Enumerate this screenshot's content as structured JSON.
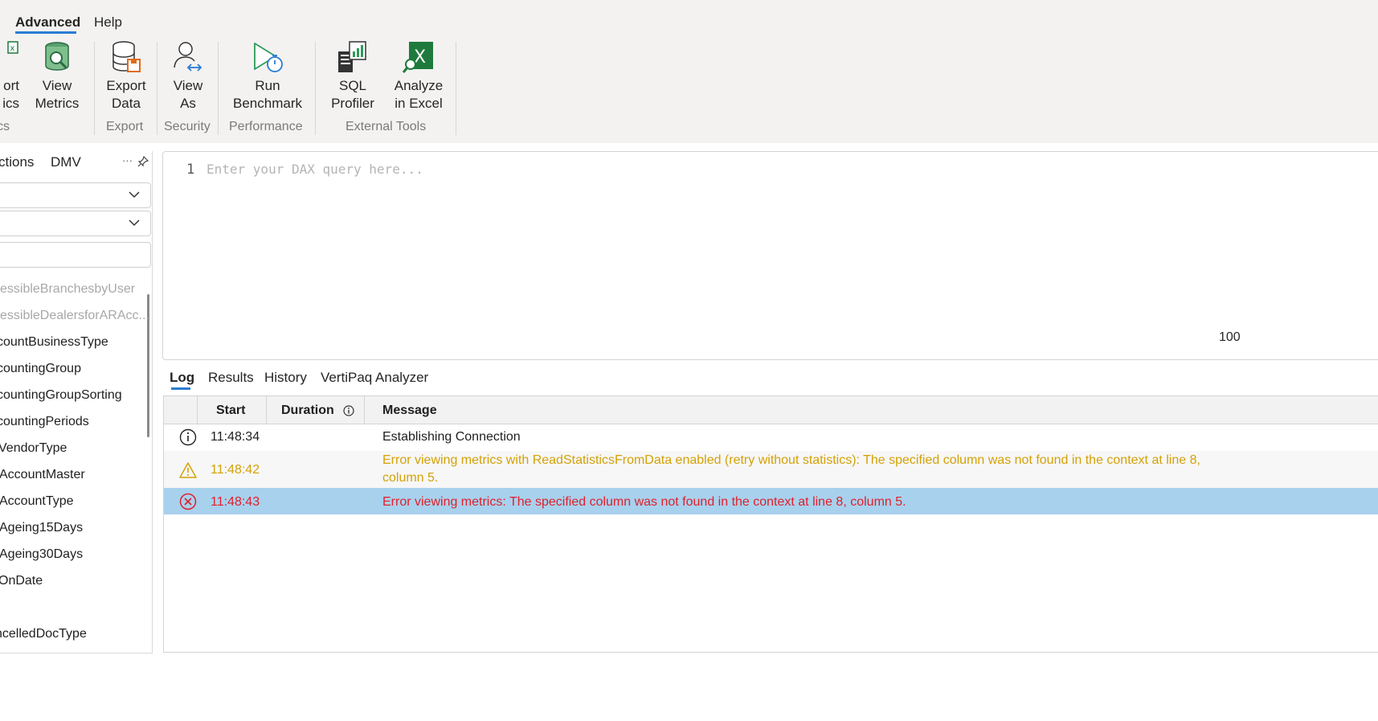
{
  "menu": {
    "tabs": [
      "Advanced",
      "Help"
    ]
  },
  "ribbon": {
    "buttons": {
      "export_metrics": [
        "ort",
        "ics"
      ],
      "view_metrics": [
        "View",
        "Metrics"
      ],
      "export_data": [
        "Export",
        "Data"
      ],
      "view_as": [
        "View",
        "As"
      ],
      "run_benchmark": [
        "Run",
        "Benchmark"
      ],
      "sql_profiler": [
        "SQL",
        "Profiler"
      ],
      "analyze_in_excel": [
        "Analyze",
        "in Excel"
      ]
    },
    "groups": {
      "metrics": "cs",
      "export": "Export",
      "security": "Security",
      "performance": "Performance",
      "external_tools": "External Tools"
    }
  },
  "left_panel": {
    "tabs": [
      "ctions",
      "DMV"
    ],
    "more_icon": "more-icon",
    "pin_icon": "pin-icon",
    "items": [
      "cessibleBranchesbyUser",
      "cessibleDealersforARAcc...",
      "countBusinessType",
      "countingGroup",
      "countingGroupSorting",
      "countingPeriods",
      "VendorType",
      "AccountMaster",
      "AccountType",
      "Ageing15Days",
      "Ageing30Days",
      "OnDate",
      "",
      "ncelledDocType"
    ]
  },
  "editor": {
    "line_number": "1",
    "placeholder": "Enter your DAX query here...",
    "zoom": "100"
  },
  "bottom_tabs": [
    "Log",
    "Results",
    "History",
    "VertiPaq Analyzer"
  ],
  "log": {
    "columns": [
      "Start",
      "Duration",
      "Message"
    ],
    "rows": [
      {
        "level": "info",
        "start": "11:48:34",
        "message": "Establishing Connection"
      },
      {
        "level": "warning",
        "start": "11:48:42",
        "message": "Error viewing metrics with ReadStatisticsFromData enabled (retry without statistics): The specified column was not found in the context at line 8, column 5."
      },
      {
        "level": "error",
        "start": "11:48:43",
        "message": "Error viewing metrics: The specified column was not found in the context at line 8, column 5."
      }
    ]
  },
  "colors": {
    "accent": "#2b7cd3",
    "selected_row": "#a8d1ee",
    "warning": "#d4a106",
    "error": "#e0202a",
    "excel_green": "#1e7a3c"
  }
}
